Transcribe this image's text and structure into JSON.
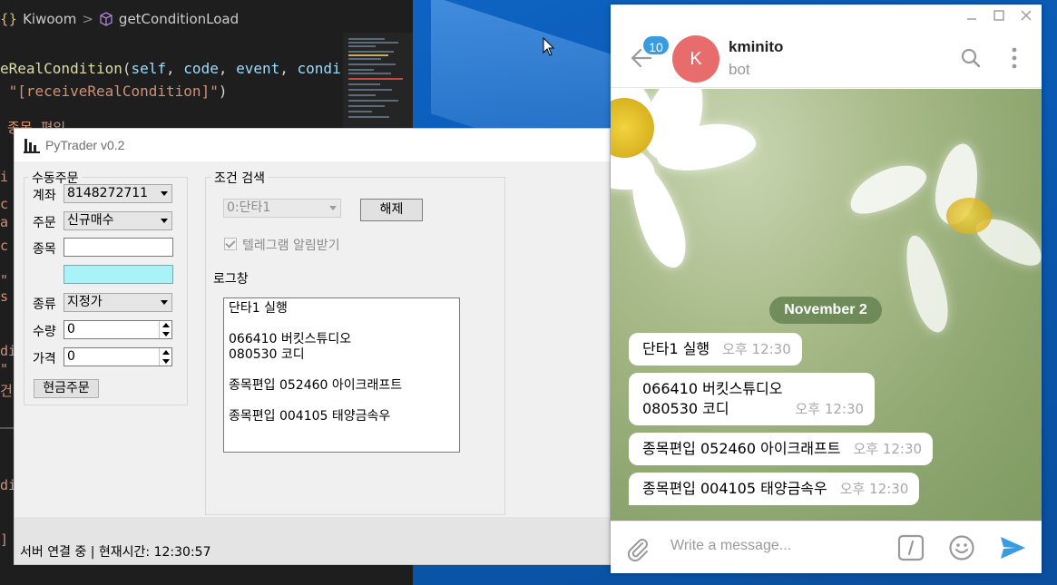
{
  "editor": {
    "breadcrumb": {
      "part1": "Kiwoom",
      "sep": ">",
      "part2": "getConditionLoad"
    },
    "line1": {
      "fn": "eRealCondition",
      "open": "(",
      "self": "self",
      "c1": ", ",
      "code": "code",
      "c2": ", ",
      "event": "event",
      "c3": ", ",
      "condi": "condi"
    },
    "line2": {
      "str": "\"[receiveRealCondition]\"",
      "close": ")"
    },
    "line3": "종목 편입",
    "strip": [
      "i",
      "c",
      "a",
      "c",
      "",
      "\"",
      "s",
      "",
      "",
      "di",
      "\"",
      "건",
      "",
      "",
      "di",
      "",
      "]"
    ]
  },
  "pytrader": {
    "title": "PyTrader v0.2",
    "manual": {
      "group_label": "수동주문",
      "account_label": "계좌",
      "account_value": "8148272711",
      "order_label": "주문",
      "order_value": "신규매수",
      "stock_label": "종목",
      "type_label": "종류",
      "type_value": "지정가",
      "qty_label": "수량",
      "qty_value": "0",
      "price_label": "가격",
      "price_value": "0",
      "cash_order_button": "현금주문"
    },
    "condition": {
      "group_label": "조건 검색",
      "select_value": "0:단타1",
      "release_button": "해제",
      "telegram_checkbox_label": "텔레그램 알림받기"
    },
    "log": {
      "label": "로그창",
      "lines": [
        "단타1 실행",
        "",
        "066410 버킷스튜디오",
        "080530 코디",
        "",
        "종목편입 052460 아이크래프트",
        "",
        "종목편입 004105 태양금속우"
      ]
    },
    "status": "서버 연결 중 | 현재시간: 12:30:57"
  },
  "telegram": {
    "unread_badge": "10",
    "avatar_letter": "K",
    "chat_name": "kminito",
    "chat_status": "bot",
    "date_pill": "November 2",
    "messages": [
      {
        "text": "단타1 실행",
        "time": "오후 12:30"
      },
      {
        "text": "066410 버킷스튜디오\n080530 코디",
        "time": "오후 12:30"
      },
      {
        "text": "종목편입 052460 아이크래프트",
        "time": "오후 12:30"
      },
      {
        "text": "종목편입 004105 태양금속우",
        "time": "오후 12:30"
      }
    ],
    "input_placeholder": "Write a message...",
    "icons": {
      "back": "back-arrow-icon",
      "search": "search-icon",
      "menu": "more-vertical-icon",
      "attach": "paperclip-icon",
      "commands": "slash-commands-icon",
      "emoji": "emoji-icon",
      "send": "send-icon"
    },
    "colors": {
      "avatar": "#e96c6c",
      "badge": "#3a9ce0",
      "send": "#3a9ce0"
    }
  }
}
